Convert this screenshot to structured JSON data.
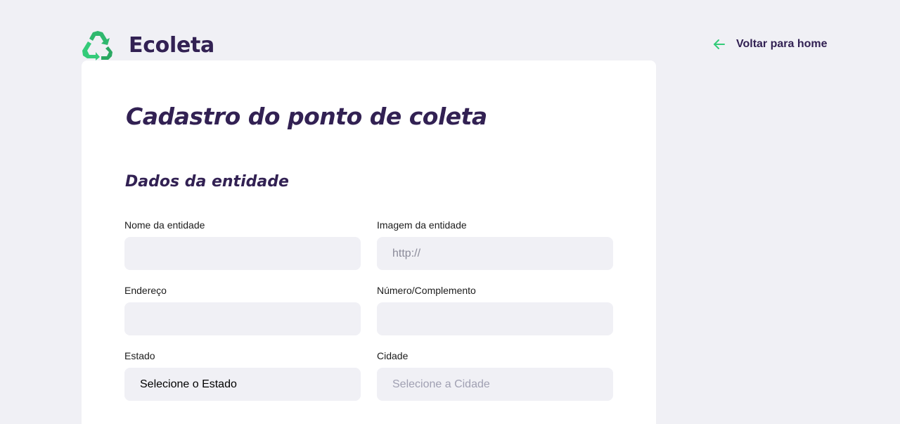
{
  "header": {
    "logo_text": "Ecoleta",
    "logo_icon": "recycle-icon",
    "back_link": {
      "label": "Voltar para home",
      "icon": "arrow-left-icon"
    }
  },
  "form": {
    "title": "Cadastro do ponto de coleta",
    "section_title": "Dados da entidade",
    "fields": {
      "name": {
        "label": "Nome da entidade",
        "value": "",
        "placeholder": ""
      },
      "image": {
        "label": "Imagem da entidade",
        "value": "",
        "placeholder": "http://"
      },
      "address": {
        "label": "Endereço",
        "value": "",
        "placeholder": ""
      },
      "number": {
        "label": "Número/Complemento",
        "value": "",
        "placeholder": ""
      },
      "state": {
        "label": "Estado",
        "selected": "Selecione o Estado"
      },
      "city": {
        "label": "Cidade",
        "selected": "Selecione a Cidade"
      }
    }
  },
  "colors": {
    "background": "#F0F0F5",
    "card": "#FFFFFF",
    "title": "#322153",
    "accent_green": "#34CB79",
    "input_background": "#F0F0F5"
  }
}
